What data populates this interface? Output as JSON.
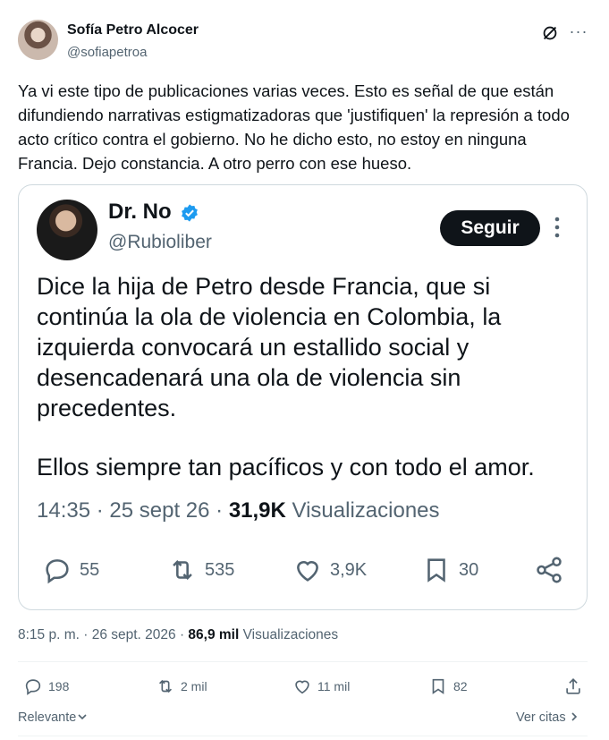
{
  "post": {
    "author_name": "Sofía Petro Alcocer",
    "author_handle": "@sofiapetroa",
    "text": "Ya vi este tipo de publicaciones varias veces. Esto es señal de que están difundiendo narrativas estigmatizadoras que 'justifiquen' la represión a todo acto crítico contra el gobierno. No he dicho esto, no estoy en ninguna Francia. Dejo constancia. A otro perro con ese hueso.",
    "time": "8:15 p. m. · 26 sept. 2026 · ",
    "views_count": "86,9 mil",
    "views_label": " Visualizaciones",
    "actions": {
      "replies": "198",
      "reposts": "2 mil",
      "likes": "11 mil",
      "bookmarks": "82"
    },
    "sort_label": "Relevante",
    "quotes_label": "Ver citas"
  },
  "quoted": {
    "author_name": "Dr. No",
    "author_handle": "@Rubioliber",
    "follow_label": "Seguir",
    "text": "Dice la hija de Petro desde Francia, que si continúa la ola de violencia en Colombia, la izquierda convocará un estallido social y desencadenará una ola de violencia sin precedentes.",
    "text2": "Ellos siempre tan pacíficos y con todo el amor.",
    "time": "14:35 · 25 sept 26 · ",
    "views_count": "31,9K",
    "views_label": " Visualizaciones",
    "actions": {
      "replies": "55",
      "reposts": "535",
      "likes": "3,9K",
      "bookmarks": "30"
    }
  },
  "colors": {
    "text": "#0f1419",
    "muted": "#536471",
    "border": "#cfd9de",
    "verified": "#1d9bf0"
  },
  "icons": [
    "grok-icon",
    "more-icon",
    "verified-icon",
    "reply-icon",
    "repost-icon",
    "like-icon",
    "bookmark-icon",
    "share-icon",
    "chevron-down-icon",
    "chevron-right-icon"
  ]
}
